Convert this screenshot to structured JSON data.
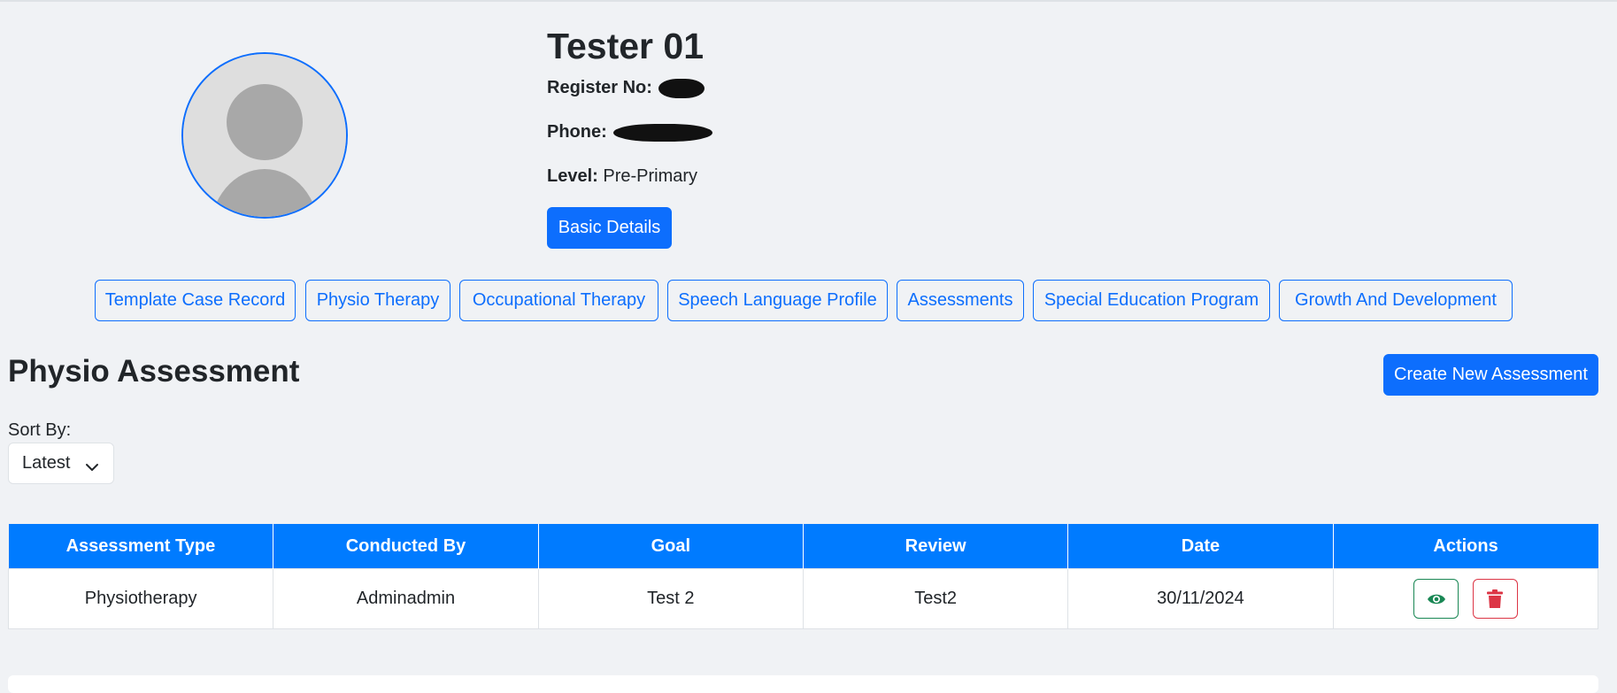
{
  "profile": {
    "name": "Tester 01",
    "register_label": "Register No:",
    "phone_label": "Phone:",
    "level_label": "Level:",
    "level_value": "Pre-Primary",
    "basic_details_label": "Basic Details"
  },
  "tabs": [
    {
      "label": "Template Case Record"
    },
    {
      "label": "Physio Therapy"
    },
    {
      "label": "Occupational Therapy"
    },
    {
      "label": "Speech Language Profile"
    },
    {
      "label": "Assessments"
    },
    {
      "label": "Special Education Program"
    },
    {
      "label": "Growth And Development"
    }
  ],
  "section": {
    "title": "Physio Assessment",
    "create_label": "Create New Assessment",
    "sort_label": "Sort By:",
    "sort_value": "Latest"
  },
  "table": {
    "headers": [
      "Assessment Type",
      "Conducted By",
      "Goal",
      "Review",
      "Date",
      "Actions"
    ],
    "rows": [
      {
        "type": "Physiotherapy",
        "conducted_by": "Adminadmin",
        "goal": "Test 2",
        "review": "Test2",
        "date": "30/11/2024"
      }
    ]
  },
  "icons": {
    "avatar": "user-avatar-icon",
    "sort_chevron": "chevron-down-icon",
    "view": "eye-icon",
    "delete": "trash-icon"
  },
  "colors": {
    "primary": "#0d6efd",
    "table_header": "#007bff",
    "view": "#198754",
    "delete": "#dc3545",
    "background": "#f0f2f5"
  }
}
